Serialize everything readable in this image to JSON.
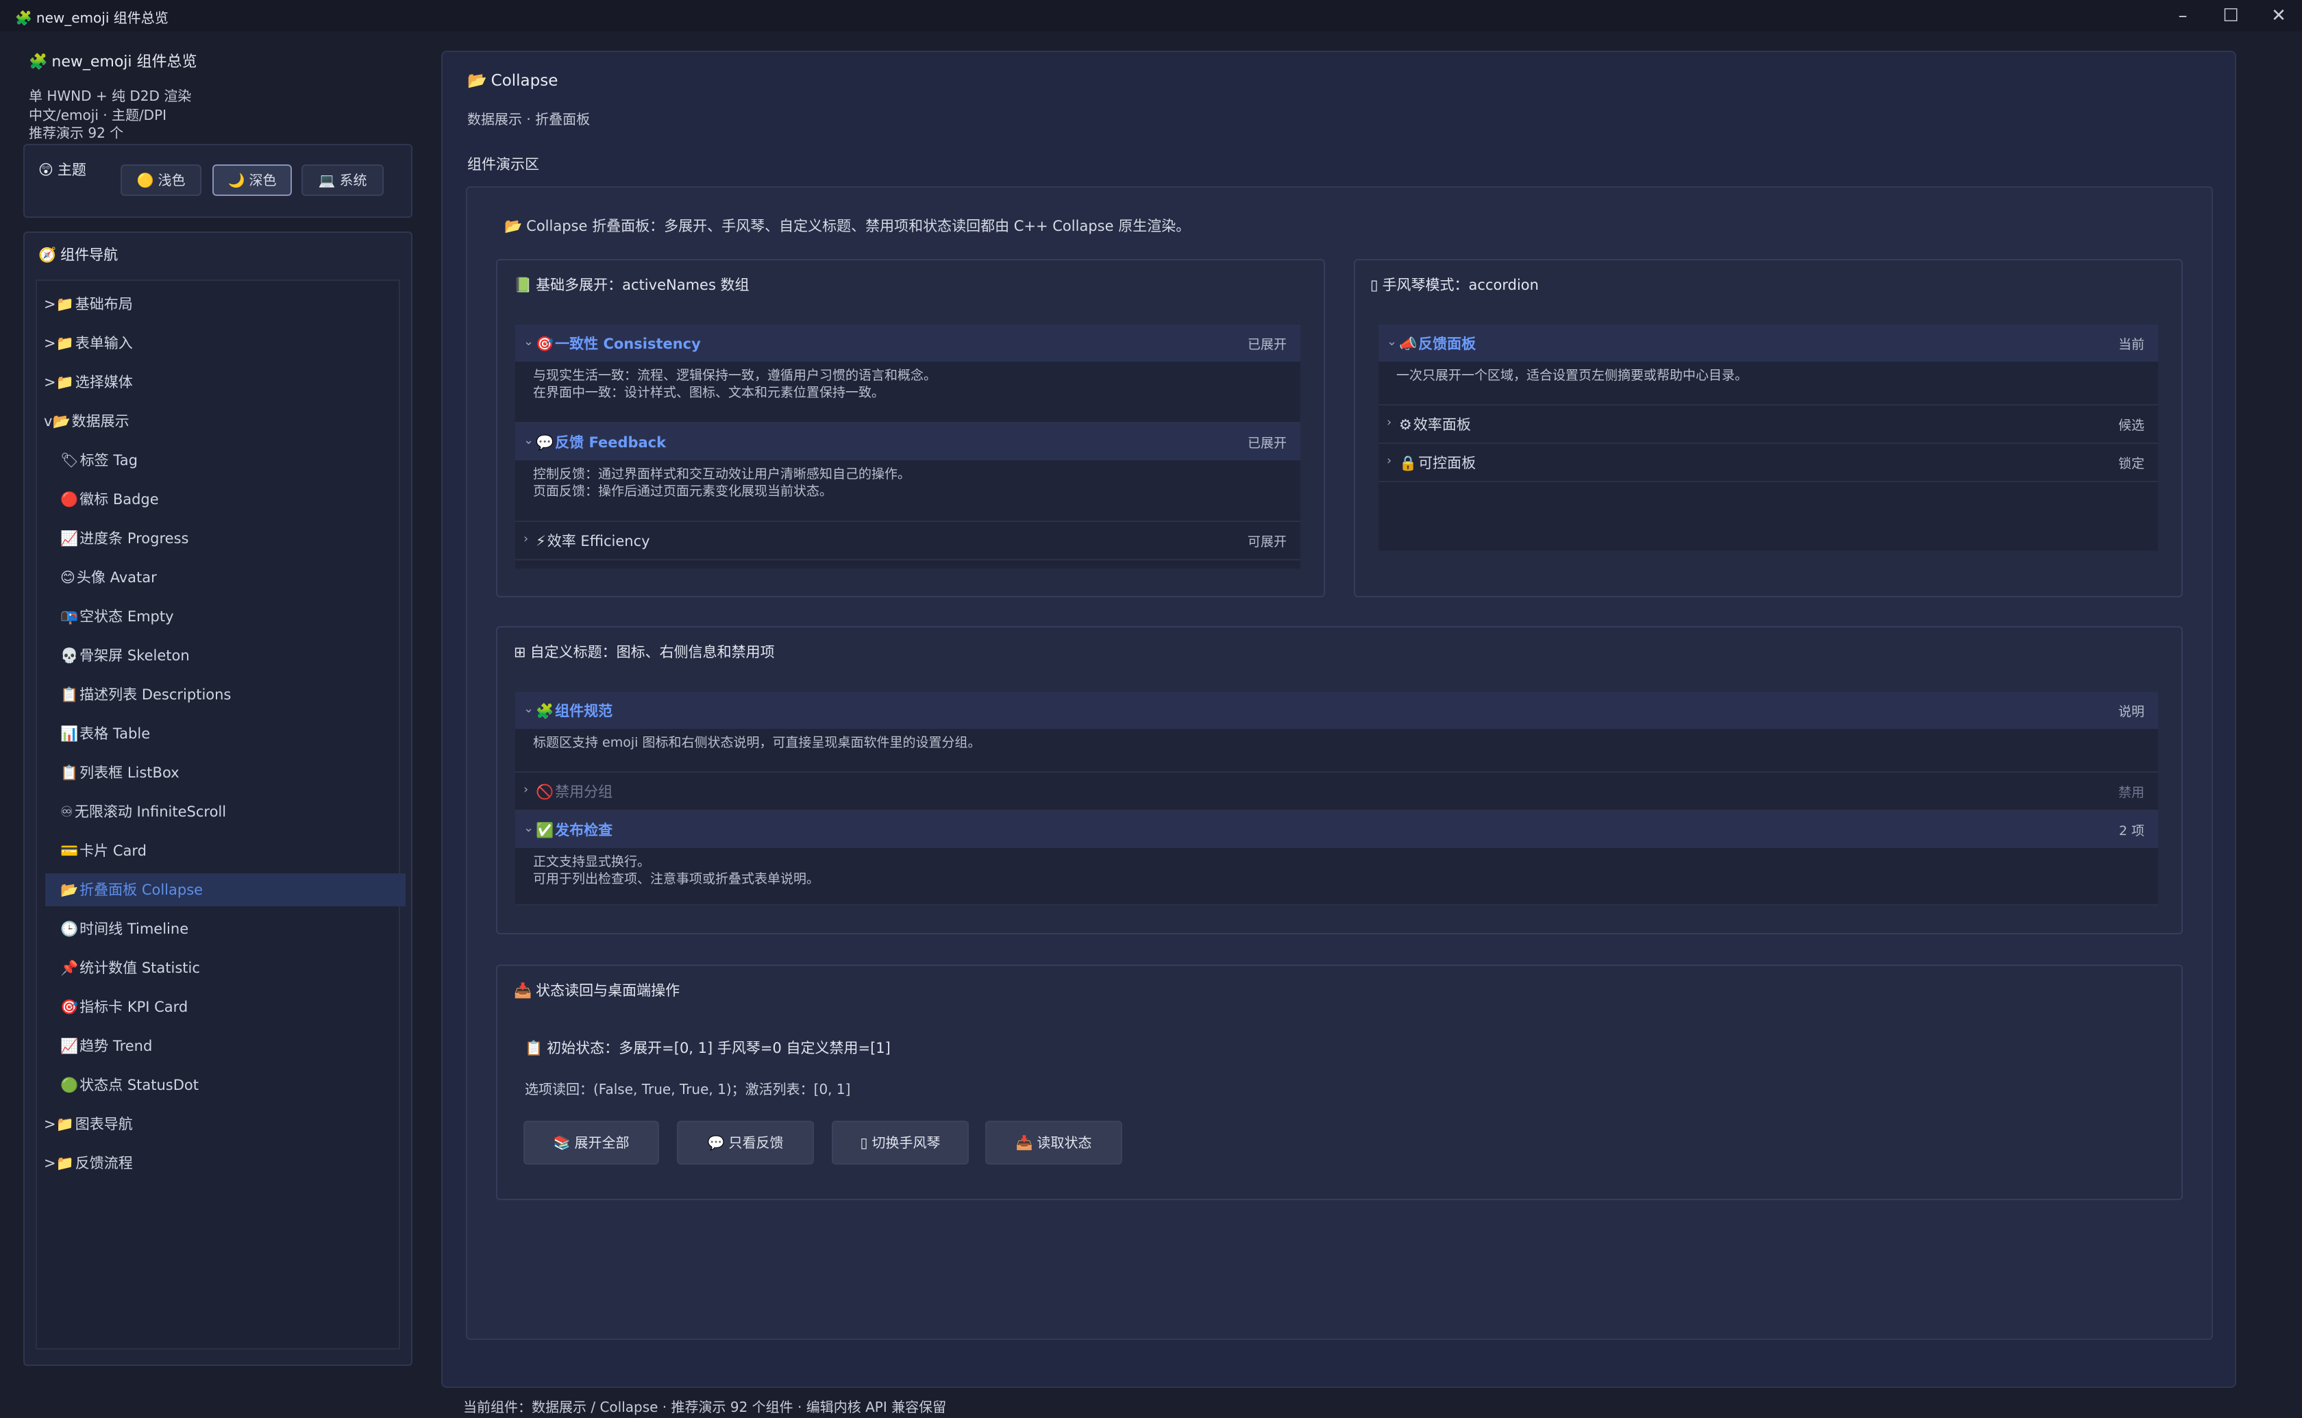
{
  "window": {
    "title": "new_emoji 组件总览",
    "icon": "puzzle-icon"
  },
  "sidebar": {
    "app_title": "new_emoji 组件总览",
    "info": [
      "单 HWND + 纯 D2D 渲染",
      "中文/emoji · 主题/DPI",
      "推荐演示 92 个"
    ],
    "theme": {
      "label": "主题",
      "options": [
        {
          "label": "浅色",
          "emoji": "🟡",
          "active": false
        },
        {
          "label": "深色",
          "emoji": "🌙",
          "active": true
        },
        {
          "label": "系统",
          "emoji": "💻",
          "active": false
        }
      ]
    },
    "nav_title": "组件导航",
    "nav_items": [
      {
        "label": "基础布局",
        "prefix": ">",
        "emoji": "📁",
        "level": 0,
        "selected": false
      },
      {
        "label": "表单输入",
        "prefix": ">",
        "emoji": "📁",
        "level": 0,
        "selected": false
      },
      {
        "label": "选择媒体",
        "prefix": ">",
        "emoji": "📁",
        "level": 0,
        "selected": false
      },
      {
        "label": "数据展示",
        "prefix": "v",
        "emoji": "📂",
        "level": 0,
        "selected": false
      },
      {
        "label": "标签 Tag",
        "prefix": "",
        "emoji": "🏷",
        "level": 1,
        "selected": false
      },
      {
        "label": "徽标 Badge",
        "prefix": "",
        "emoji": "🔴",
        "level": 1,
        "selected": false
      },
      {
        "label": "进度条 Progress",
        "prefix": "",
        "emoji": "📈",
        "level": 1,
        "selected": false
      },
      {
        "label": "头像 Avatar",
        "prefix": "",
        "emoji": "😊",
        "level": 1,
        "selected": false
      },
      {
        "label": "空状态 Empty",
        "prefix": "",
        "emoji": "📭",
        "level": 1,
        "selected": false
      },
      {
        "label": "骨架屏 Skeleton",
        "prefix": "",
        "emoji": "💀",
        "level": 1,
        "selected": false
      },
      {
        "label": "描述列表 Descriptions",
        "prefix": "",
        "emoji": "📋",
        "level": 1,
        "selected": false
      },
      {
        "label": "表格 Table",
        "prefix": "",
        "emoji": "📊",
        "level": 1,
        "selected": false
      },
      {
        "label": "列表框 ListBox",
        "prefix": "",
        "emoji": "📋",
        "level": 1,
        "selected": false
      },
      {
        "label": "无限滚动 InfiniteScroll",
        "prefix": "",
        "emoji": "♾",
        "level": 1,
        "selected": false
      },
      {
        "label": "卡片 Card",
        "prefix": "",
        "emoji": "💳",
        "level": 1,
        "selected": false
      },
      {
        "label": "折叠面板 Collapse",
        "prefix": "",
        "emoji": "📂",
        "level": 1,
        "selected": true
      },
      {
        "label": "时间线 Timeline",
        "prefix": "",
        "emoji": "🕒",
        "level": 1,
        "selected": false
      },
      {
        "label": "统计数值 Statistic",
        "prefix": "",
        "emoji": "📌",
        "level": 1,
        "selected": false
      },
      {
        "label": "指标卡 KPI Card",
        "prefix": "",
        "emoji": "🎯",
        "level": 1,
        "selected": false
      },
      {
        "label": "趋势 Trend",
        "prefix": "",
        "emoji": "📈",
        "level": 1,
        "selected": false
      },
      {
        "label": "状态点 StatusDot",
        "prefix": "",
        "emoji": "🟢",
        "level": 1,
        "selected": false
      },
      {
        "label": "图表导航",
        "prefix": ">",
        "emoji": "📁",
        "level": 0,
        "selected": false
      },
      {
        "label": "反馈流程",
        "prefix": ">",
        "emoji": "📁",
        "level": 0,
        "selected": false
      }
    ]
  },
  "main": {
    "title": "Collapse",
    "subtitle": "数据展示 · 折叠面板",
    "demo_label": "组件演示区",
    "intro": "Collapse 折叠面板：多展开、手风琴、自定义标题、禁用项和状态读回都由 C++ Collapse 原生渲染。",
    "basic": {
      "title": "基础多展开：activeNames 数组",
      "items": [
        {
          "title": "一致性 Consistency",
          "emoji": "🎯",
          "meta": "已展开",
          "open": true,
          "disabled": false,
          "body": [
            "与现实生活一致：流程、逻辑保持一致，遵循用户习惯的语言和概念。",
            "在界面中一致：设计样式、图标、文本和元素位置保持一致。"
          ]
        },
        {
          "title": "反馈 Feedback",
          "emoji": "💬",
          "meta": "已展开",
          "open": true,
          "disabled": false,
          "body": [
            "控制反馈：通过界面样式和交互动效让用户清晰感知自己的操作。",
            "页面反馈：操作后通过页面元素变化展现当前状态。"
          ]
        },
        {
          "title": "效率 Efficiency",
          "emoji": "⚡",
          "meta": "可展开",
          "open": false,
          "disabled": false,
          "body": []
        }
      ]
    },
    "accordion": {
      "title": "手风琴模式：accordion",
      "items": [
        {
          "title": "反馈面板",
          "emoji": "📣",
          "meta": "当前",
          "open": true,
          "disabled": false,
          "body": [
            "一次只展开一个区域，适合设置页左侧摘要或帮助中心目录。"
          ]
        },
        {
          "title": "效率面板",
          "emoji": "⚙",
          "meta": "候选",
          "open": false,
          "disabled": false,
          "body": []
        },
        {
          "title": "可控面板",
          "emoji": "🔒",
          "meta": "锁定",
          "open": false,
          "disabled": false,
          "body": []
        }
      ]
    },
    "custom": {
      "title": "自定义标题：图标、右侧信息和禁用项",
      "items": [
        {
          "title": "组件规范",
          "emoji": "🧩",
          "meta": "说明",
          "open": true,
          "disabled": false,
          "body": [
            "标题区支持 emoji 图标和右侧状态说明，可直接呈现桌面软件里的设置分组。"
          ]
        },
        {
          "title": "禁用分组",
          "emoji": "🚫",
          "meta": "禁用",
          "open": false,
          "disabled": true,
          "body": []
        },
        {
          "title": "发布检查",
          "emoji": "✅",
          "meta": "2 项",
          "open": true,
          "disabled": false,
          "body": [
            "正文支持显式换行。",
            "可用于列出检查项、注意事项或折叠式表单说明。"
          ]
        }
      ]
    },
    "state": {
      "title": "状态读回与桌面端操作",
      "initial": "初始状态：多展开=[0, 1] 手风琴=0 自定义禁用=[1]",
      "readback": "选项读回：(False, True, True, 1)；激活列表：[0, 1]",
      "buttons": [
        {
          "label": "展开全部",
          "emoji": "📚"
        },
        {
          "label": "只看反馈",
          "emoji": "💬"
        },
        {
          "label": "切换手风琴",
          "emoji": "▯"
        },
        {
          "label": "读取状态",
          "emoji": "📥"
        }
      ]
    }
  },
  "statusbar": "当前组件：数据展示 / Collapse · 推荐演示 92 个组件 · 编辑内核 API 兼容保留",
  "colors": {
    "accent": "#6b9cff",
    "background": "#1b1f2d",
    "panel": "#222841",
    "selected_nav": "#273457"
  }
}
